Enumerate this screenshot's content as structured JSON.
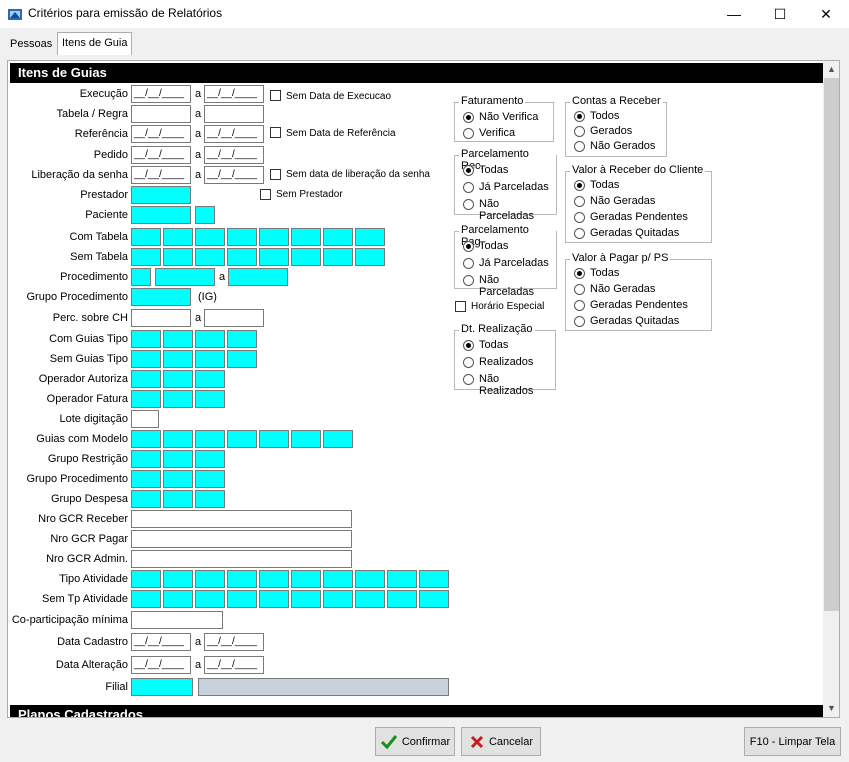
{
  "window": {
    "title": "Critérios para emissão de Relatórios",
    "minimize": "—",
    "maximize": "☐",
    "close": "✕"
  },
  "tabs": [
    {
      "label": "Pessoas"
    },
    {
      "label": "Itens de Guia"
    }
  ],
  "section": {
    "title": "Itens de Guias",
    "bottom_title": "Planos Cadastrados"
  },
  "labels": {
    "execucao": "Execução",
    "tabela_regra": "Tabela / Regra",
    "referencia": "Referência",
    "pedido": "Pedido",
    "liberacao": "Liberação da senha",
    "prestador": "Prestador",
    "paciente": "Paciente",
    "com_tabela": "Com Tabela",
    "sem_tabela": "Sem Tabela",
    "procedimento": "Procedimento",
    "grupo_procedimento": "Grupo Procedimento",
    "perc_ch": "Perc. sobre CH",
    "com_guias_tipo": "Com Guias Tipo",
    "sem_guias_tipo": "Sem Guias Tipo",
    "operador_autoriza": "Operador Autoriza",
    "operador_fatura": "Operador Fatura",
    "lote_digitacao": "Lote digitação",
    "guias_com_modelo": "Guias com Modelo",
    "grupo_restricao": "Grupo Restrição",
    "grupo_procedimento2": "Grupo Procedimento",
    "grupo_despesa": "Grupo Despesa",
    "nro_gcr_receber": "Nro GCR Receber",
    "nro_gcr_pagar": "Nro GCR Pagar",
    "nro_gcr_admin": "Nro GCR Admin.",
    "tipo_atividade": "Tipo Atividade",
    "sem_tp_atividade": "Sem Tp Atividade",
    "coparticipacao": "Co-participação mínima",
    "data_cadastro": "Data Cadastro",
    "data_alteracao": "Data Alteração",
    "filial": "Filial",
    "a": "a",
    "ig": "(IG)"
  },
  "date_mask": "__/__/____",
  "checkboxes": {
    "sem_data_execucao": "Sem Data de Execucao",
    "sem_data_referencia": "Sem Data de Referência",
    "sem_data_liberacao": "Sem data de liberação da senha",
    "sem_prestador": "Sem Prestador",
    "horario_especial": "Horário Especial"
  },
  "groups": {
    "faturamento": {
      "title": "Faturamento",
      "options": [
        "Não Verifica",
        "Verifica"
      ],
      "selected": 0
    },
    "parcelamento_rec": {
      "title": "Parcelamento Rec.",
      "options": [
        "Todas",
        "Já Parceladas",
        "Não Parceladas"
      ],
      "selected": 0
    },
    "parcelamento_pag": {
      "title": "Parcelamento Pag.",
      "options": [
        "Todas",
        "Já Parceladas",
        "Não Parceladas"
      ],
      "selected": 0
    },
    "dt_realizacao": {
      "title": "Dt. Realização",
      "options": [
        "Todas",
        "Realizados",
        "Não Realizados"
      ],
      "selected": 0
    },
    "contas_receber": {
      "title": "Contas a Receber",
      "options": [
        "Todos",
        "Gerados",
        "Não Gerados"
      ],
      "selected": 0
    },
    "valor_receber": {
      "title": "Valor à Receber do Cliente",
      "options": [
        "Todas",
        "Não Geradas",
        "Geradas Pendentes",
        "Geradas Quitadas"
      ],
      "selected": 0
    },
    "valor_pagar": {
      "title": "Valor à Pagar p/ PS",
      "options": [
        "Todas",
        "Não Geradas",
        "Geradas Pendentes",
        "Geradas Quitadas"
      ],
      "selected": 0
    }
  },
  "buttons": {
    "confirmar": "Confirmar",
    "cancelar": "Cancelar",
    "limpar": "F10 - Limpar Tela"
  },
  "colors": {
    "field_accent": "#00ffff",
    "header": "#000000"
  }
}
